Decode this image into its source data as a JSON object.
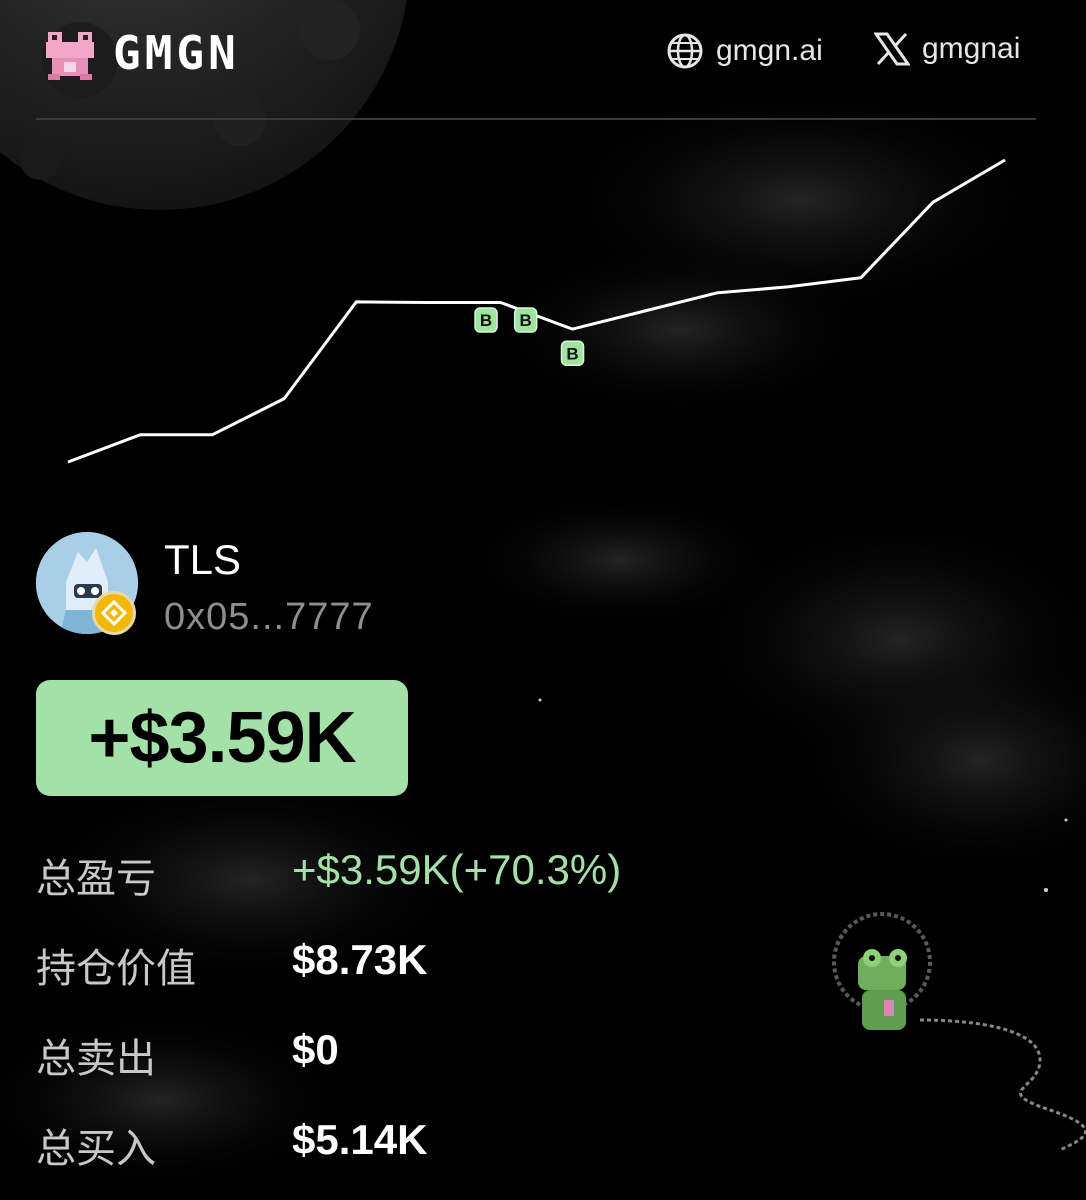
{
  "header": {
    "brand": "GMGN",
    "website": "gmgn.ai",
    "x_handle": "gmgnai"
  },
  "chart_data": {
    "type": "line",
    "x": [
      0,
      1,
      2,
      3,
      4,
      5,
      6,
      7,
      8,
      9,
      10,
      11,
      12,
      13
    ],
    "values": [
      0.0,
      0.9,
      0.9,
      2.1,
      5.3,
      5.28,
      5.28,
      4.4,
      5.0,
      5.6,
      5.8,
      6.1,
      8.6,
      10.0
    ],
    "buy_markers": [
      {
        "label": "B",
        "x": 5.8,
        "y": 4.7
      },
      {
        "label": "B",
        "x": 6.35,
        "y": 4.7
      },
      {
        "label": "B",
        "x": 7.0,
        "y": 3.6
      }
    ],
    "title": "",
    "xlabel": "",
    "ylabel": "",
    "ylim": [
      0,
      10
    ],
    "grid": false,
    "axes_visible": false,
    "line_color": "#ffffff"
  },
  "profile": {
    "name": "TLS",
    "address": "0x05...7777"
  },
  "pnl": {
    "value": "+$3.59K",
    "color": "#a4e1a8"
  },
  "stats": [
    {
      "label": "总盈亏",
      "value": "+$3.59K(+70.3%)",
      "highlight": true
    },
    {
      "label": "持仓价值",
      "value": "$8.73K",
      "highlight": false
    },
    {
      "label": "总卖出",
      "value": "$0",
      "highlight": false
    },
    {
      "label": "总买入",
      "value": "$5.14K",
      "highlight": false
    }
  ],
  "icons": [
    "frog-logo-icon",
    "globe-icon",
    "x-logo-icon",
    "bnb-chain-icon",
    "astronaut-frog-icon"
  ]
}
